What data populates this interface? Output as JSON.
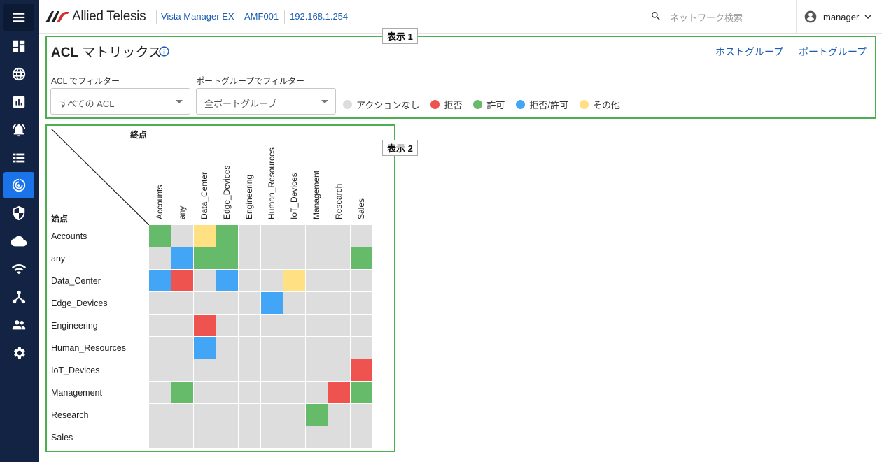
{
  "nav": {
    "items": [
      {
        "icon": "menu-icon",
        "name": "menu"
      },
      {
        "icon": "dashboard-icon",
        "name": "dashboard"
      },
      {
        "icon": "globe-icon",
        "name": "network-map"
      },
      {
        "icon": "bar-chart-icon",
        "name": "reports"
      },
      {
        "icon": "bell-icon",
        "name": "alarms"
      },
      {
        "icon": "list-icon",
        "name": "assets"
      },
      {
        "icon": "radar-icon",
        "name": "acl-matrix"
      },
      {
        "icon": "shield-icon",
        "name": "security"
      },
      {
        "icon": "cloud-icon",
        "name": "cloud"
      },
      {
        "icon": "wifi-icon",
        "name": "wireless"
      },
      {
        "icon": "hierarchy-icon",
        "name": "topology"
      },
      {
        "icon": "users-icon",
        "name": "users"
      },
      {
        "icon": "gear-icon",
        "name": "settings"
      }
    ]
  },
  "header": {
    "brand": "Allied Telesis",
    "product": "Vista Manager EX",
    "device": "AMF001",
    "ip": "192.168.1.254",
    "search_placeholder": "ネットワーク検索",
    "user": "manager"
  },
  "section1": {
    "callout": "表示 1",
    "title_bold": "ACL",
    "title_rest": " マトリックス",
    "links": [
      "ホストグループ",
      "ポートグループ"
    ],
    "acl_filter": {
      "label": "ACL でフィルター",
      "value": "すべての ACL"
    },
    "port_filter": {
      "label": "ポートグループでフィルター",
      "value": "全ポートグループ"
    },
    "legend": [
      {
        "label": "アクションなし",
        "color": "#dddddd"
      },
      {
        "label": "拒否",
        "color": "#ef5350"
      },
      {
        "label": "許可",
        "color": "#66bb6a"
      },
      {
        "label": "拒否/許可",
        "color": "#42a5f5"
      },
      {
        "label": "その他",
        "color": "#ffe082"
      }
    ]
  },
  "section2": {
    "callout": "表示 2",
    "end_label": "終点",
    "start_label": "始点",
    "columns": [
      "Accounts",
      "any",
      "Data_Center",
      "Edge_Devices",
      "Engineering",
      "Human_Resources",
      "IoT_Devices",
      "Management",
      "Research",
      "Sales"
    ],
    "rows": [
      "Accounts",
      "any",
      "Data_Center",
      "Edge_Devices",
      "Engineering",
      "Human_Resources",
      "IoT_Devices",
      "Management",
      "Research",
      "Sales"
    ],
    "colors": {
      "n": "#dddddd",
      "d": "#ef5350",
      "p": "#66bb6a",
      "b": "#42a5f5",
      "o": "#ffe082"
    },
    "matrix": [
      [
        "p",
        "n",
        "o",
        "p",
        "n",
        "n",
        "n",
        "n",
        "n",
        "n"
      ],
      [
        "n",
        "b",
        "p",
        "p",
        "n",
        "n",
        "n",
        "n",
        "n",
        "p"
      ],
      [
        "b",
        "d",
        "n",
        "b",
        "n",
        "n",
        "o",
        "n",
        "n",
        "n"
      ],
      [
        "n",
        "n",
        "n",
        "n",
        "n",
        "b",
        "n",
        "n",
        "n",
        "n"
      ],
      [
        "n",
        "n",
        "d",
        "n",
        "n",
        "n",
        "n",
        "n",
        "n",
        "n"
      ],
      [
        "n",
        "n",
        "b",
        "n",
        "n",
        "n",
        "n",
        "n",
        "n",
        "n"
      ],
      [
        "n",
        "n",
        "n",
        "n",
        "n",
        "n",
        "n",
        "n",
        "n",
        "d"
      ],
      [
        "n",
        "p",
        "n",
        "n",
        "n",
        "n",
        "n",
        "n",
        "d",
        "p"
      ],
      [
        "n",
        "n",
        "n",
        "n",
        "n",
        "n",
        "n",
        "p",
        "n",
        "n"
      ],
      [
        "n",
        "n",
        "n",
        "n",
        "n",
        "n",
        "n",
        "n",
        "n",
        "n"
      ]
    ]
  }
}
